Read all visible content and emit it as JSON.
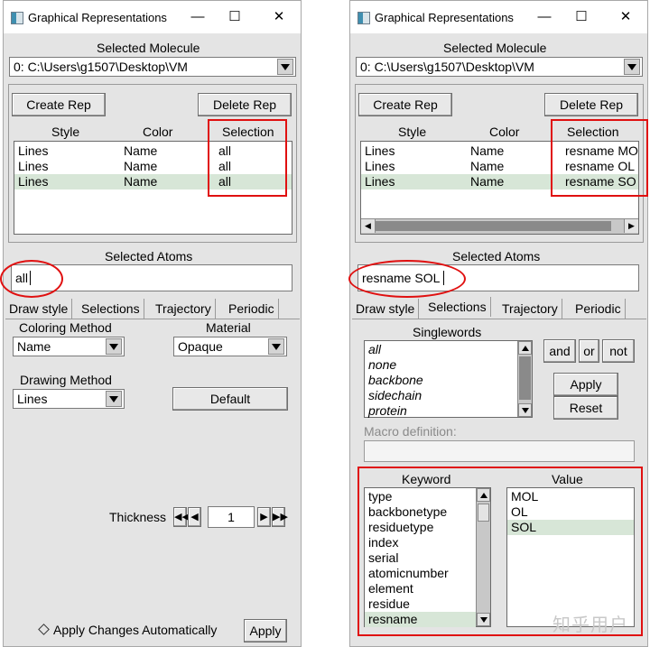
{
  "watermark": "知乎用户",
  "windows": {
    "left": {
      "title": "Graphical Representations",
      "selected_molecule_label": "Selected Molecule",
      "molecule": "0: C:\\Users\\g1507\\Desktop\\VM",
      "create_rep": "Create Rep",
      "delete_rep": "Delete Rep",
      "col_style": "Style",
      "col_color": "Color",
      "col_selection": "Selection",
      "reps": [
        {
          "style": "Lines",
          "color": "Name",
          "selection": "all"
        },
        {
          "style": "Lines",
          "color": "Name",
          "selection": "all"
        },
        {
          "style": "Lines",
          "color": "Name",
          "selection": "all"
        }
      ],
      "selected_atoms_label": "Selected Atoms",
      "selected_atoms": "all",
      "tabs": [
        "Draw style",
        "Selections",
        "Trajectory",
        "Periodic"
      ],
      "coloring_method_label": "Coloring Method",
      "coloring_method": "Name",
      "material_label": "Material",
      "material": "Opaque",
      "drawing_method_label": "Drawing Method",
      "drawing_method": "Lines",
      "default_button": "Default",
      "thickness_label": "Thickness",
      "thickness": "1",
      "apply_auto": "Apply Changes Automatically",
      "apply": "Apply"
    },
    "right": {
      "title": "Graphical Representations",
      "selected_molecule_label": "Selected Molecule",
      "molecule": "0: C:\\Users\\g1507\\Desktop\\VM",
      "create_rep": "Create Rep",
      "delete_rep": "Delete Rep",
      "col_style": "Style",
      "col_color": "Color",
      "col_selection": "Selection",
      "reps": [
        {
          "style": "Lines",
          "color": "Name",
          "selection": "resname MO"
        },
        {
          "style": "Lines",
          "color": "Name",
          "selection": "resname OL"
        },
        {
          "style": "Lines",
          "color": "Name",
          "selection": "resname SO"
        }
      ],
      "selected_atoms_label": "Selected Atoms",
      "selected_atoms": "resname SOL",
      "tabs": [
        "Draw style",
        "Selections",
        "Trajectory",
        "Periodic"
      ],
      "singlewords_label": "Singlewords",
      "singlewords": [
        "all",
        "none",
        "backbone",
        "sidechain",
        "protein"
      ],
      "and": "and",
      "or": "or",
      "not": "not",
      "apply": "Apply",
      "reset": "Reset",
      "macro_label": "Macro definition:",
      "keyword_label": "Keyword",
      "keywords": [
        "type",
        "backbonetype",
        "residuetype",
        "index",
        "serial",
        "atomicnumber",
        "element",
        "residue",
        "resname"
      ],
      "value_label": "Value",
      "values": [
        "MOL",
        "OL",
        "SOL"
      ]
    }
  }
}
